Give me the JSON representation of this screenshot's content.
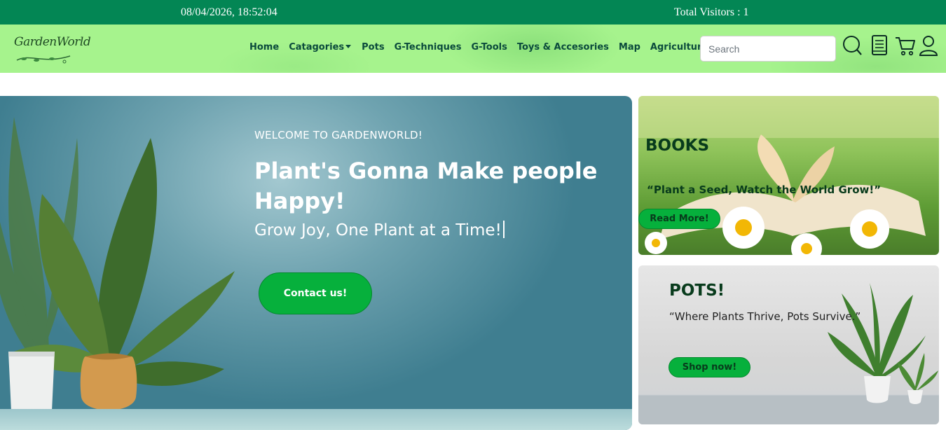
{
  "topbar": {
    "datetime": "08/04/2026, 18:52:04",
    "visitors": "Total Visitors : 1"
  },
  "brand": {
    "logo_text": "GardenWorld"
  },
  "nav": {
    "items": [
      {
        "label": "Home",
        "dropdown": false
      },
      {
        "label": "Catagories",
        "dropdown": true
      },
      {
        "label": "Pots",
        "dropdown": false
      },
      {
        "label": "G-Techniques",
        "dropdown": false
      },
      {
        "label": "G-Tools",
        "dropdown": false
      },
      {
        "label": "Toys & Accesories",
        "dropdown": false
      },
      {
        "label": "Map",
        "dropdown": false
      },
      {
        "label": "Agriculture",
        "dropdown": true
      }
    ],
    "search_placeholder": "Search",
    "icons": [
      "search-icon",
      "book-icon",
      "cart-icon",
      "user-icon"
    ]
  },
  "hero": {
    "welcome": "WELCOME TO GARDENWORLD!",
    "headline": "Plant's Gonna Make people Happy!",
    "subline": "Grow Joy, One Plant at a Time!",
    "cta_label": "Contact us!"
  },
  "cards": {
    "books": {
      "title": "BOOKS",
      "quote": "“Plant a Seed, Watch the World Grow!”",
      "button": "Read More!"
    },
    "pots": {
      "title": "POTS!",
      "quote": "“Where Plants Thrive, Pots Survive.”",
      "button": "Shop now!"
    }
  },
  "colors": {
    "topbar": "#038654",
    "navbar": "#a6f38d",
    "nav_text": "#0b4b3c",
    "button": "#06b03c",
    "card_title": "#083b1c"
  }
}
